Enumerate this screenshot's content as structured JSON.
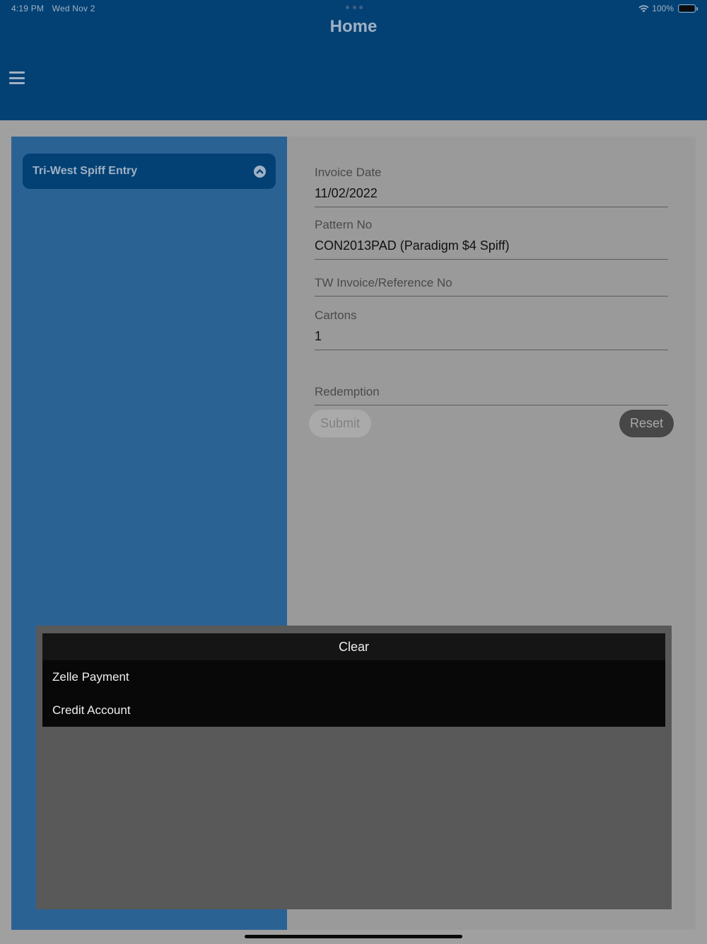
{
  "status_bar": {
    "time": "4:19 PM",
    "date": "Wed Nov 2",
    "battery": "100%"
  },
  "header": {
    "title": "Home",
    "menu_icon": "hamburger-menu-icon"
  },
  "sidebar": {
    "accordion_title": "Tri-West Spiff Entry",
    "accordion_icon": "chevron-up-circle-icon"
  },
  "form": {
    "invoice_date": {
      "label": "Invoice Date",
      "value": "11/02/2022"
    },
    "pattern_no": {
      "label": "Pattern No",
      "value": "CON2013PAD (Paradigm $4 Spiff)"
    },
    "tw_invoice": {
      "label": "TW Invoice/Reference No",
      "value": ""
    },
    "cartons": {
      "label": "Cartons",
      "value": "1"
    },
    "redemption": {
      "label": "Redemption",
      "value": ""
    },
    "submit_label": "Submit",
    "reset_label": "Reset"
  },
  "picker": {
    "clear_label": "Clear",
    "options": [
      "Zelle Payment",
      "Credit Account"
    ]
  },
  "colors": {
    "header_bg": "#034174",
    "sidebar_bg": "#2b6294",
    "content_bg": "#9a9a9a"
  }
}
